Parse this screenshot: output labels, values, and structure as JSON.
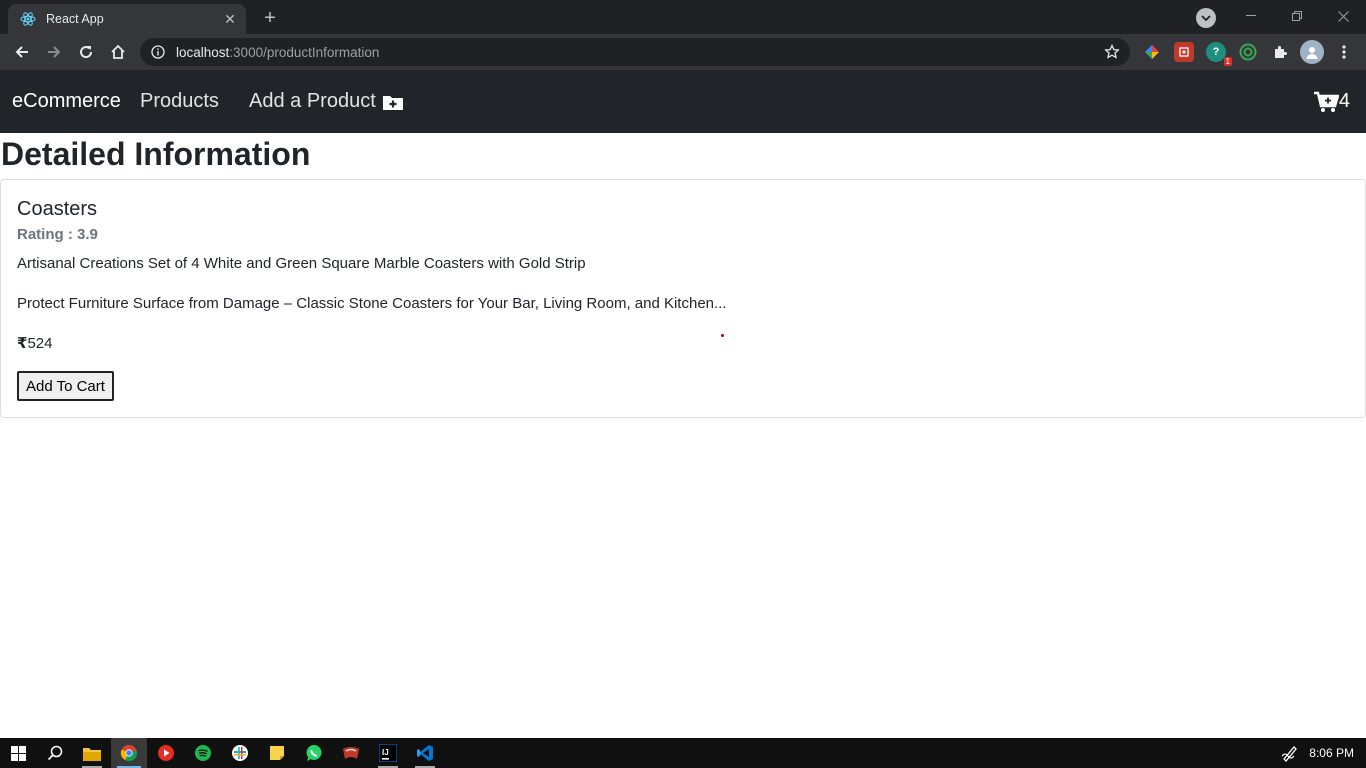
{
  "browser": {
    "tab_title": "React App",
    "url_host": "localhost",
    "url_rest": ":3000/productInformation"
  },
  "navbar": {
    "brand": "eCommerce",
    "products": "Products",
    "add_product": "Add a Product",
    "cart_count": "4"
  },
  "page": {
    "title": "Detailed Information"
  },
  "product": {
    "name": "Coasters",
    "rating": "Rating : 3.9",
    "title_line": "Artisanal Creations Set of 4 White and Green Square Marble Coasters with Gold Strip",
    "description": "Protect Furniture Surface from Damage – Classic Stone Coasters for Your Bar, Living Room, and Kitchen...",
    "currency_symbol": "₹",
    "price": "524",
    "add_to_cart": "Add To Cart"
  },
  "taskbar": {
    "time": "8:06 PM"
  },
  "icons": {
    "favicon": "react-icon",
    "cart": "cart-icon",
    "add_product": "folder-plus-icon"
  },
  "colors": {
    "navbar_bg": "#212529",
    "chrome_bg": "#35363a",
    "titlebar_bg": "#202124"
  }
}
